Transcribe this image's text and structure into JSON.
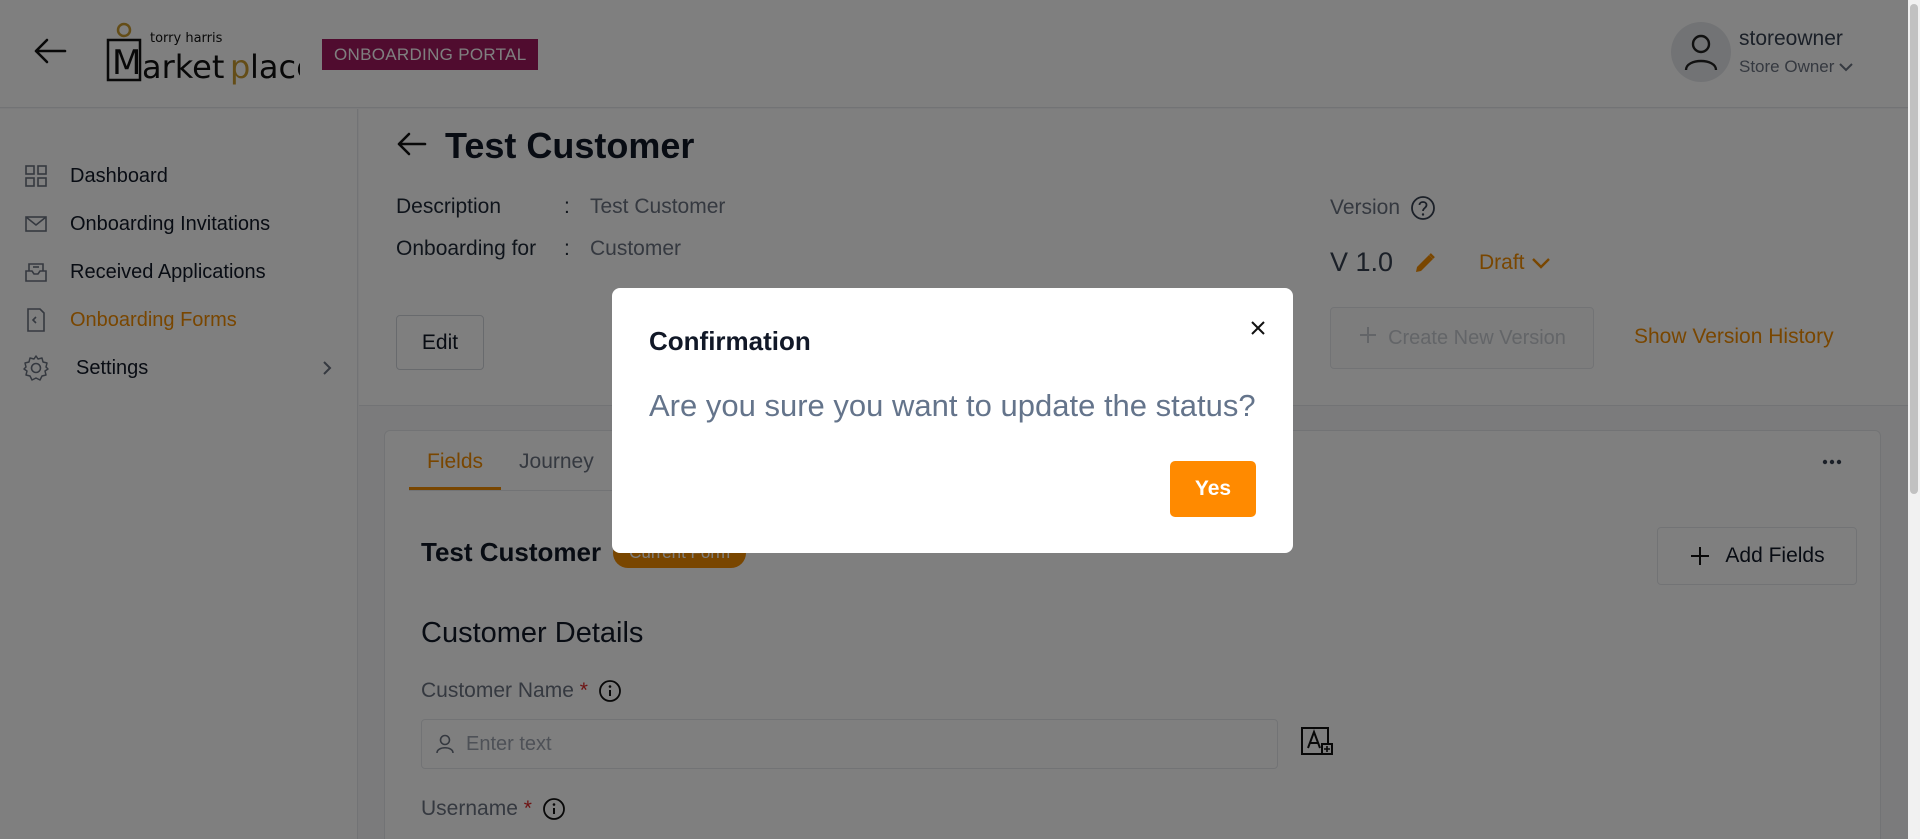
{
  "header": {
    "portal_badge": "ONBOARDING PORTAL",
    "logo_text": "torry harris Marketplace",
    "user": {
      "name": "storeowner",
      "role": "Store Owner"
    }
  },
  "sidebar": {
    "items": [
      {
        "label": "Dashboard",
        "icon": "dashboard-icon"
      },
      {
        "label": "Onboarding Invitations",
        "icon": "mail-icon"
      },
      {
        "label": "Received Applications",
        "icon": "inbox-icon"
      },
      {
        "label": "Onboarding Forms",
        "icon": "form-icon",
        "active": true
      },
      {
        "label": "Settings",
        "icon": "gear-icon"
      }
    ]
  },
  "page": {
    "title": "Test Customer",
    "description_label": "Description",
    "description_value": "Test Customer",
    "onboarding_for_label": "Onboarding for",
    "onboarding_for_value": "Customer",
    "colon": ":",
    "edit_label": "Edit",
    "version_label": "Version",
    "version_value": "V 1.0",
    "status": "Draft",
    "create_version_label": "Create New Version",
    "version_history_label": "Show Version History"
  },
  "form": {
    "tabs": [
      {
        "label": "Fields",
        "active": true
      },
      {
        "label": "Journey"
      }
    ],
    "title": "Test Customer",
    "current_badge": "Current Form",
    "add_fields_label": "Add Fields",
    "section_title": "Customer Details",
    "field1_label": "Customer Name",
    "field1_placeholder": "Enter text",
    "field2_label": "Username",
    "required_mark": "*"
  },
  "modal": {
    "title": "Confirmation",
    "message": "Are you sure you want to update the status?",
    "yes_label": "Yes"
  },
  "colors": {
    "accent": "#f28c00",
    "badge": "#a0195f",
    "yes_button": "#ff8a00"
  }
}
